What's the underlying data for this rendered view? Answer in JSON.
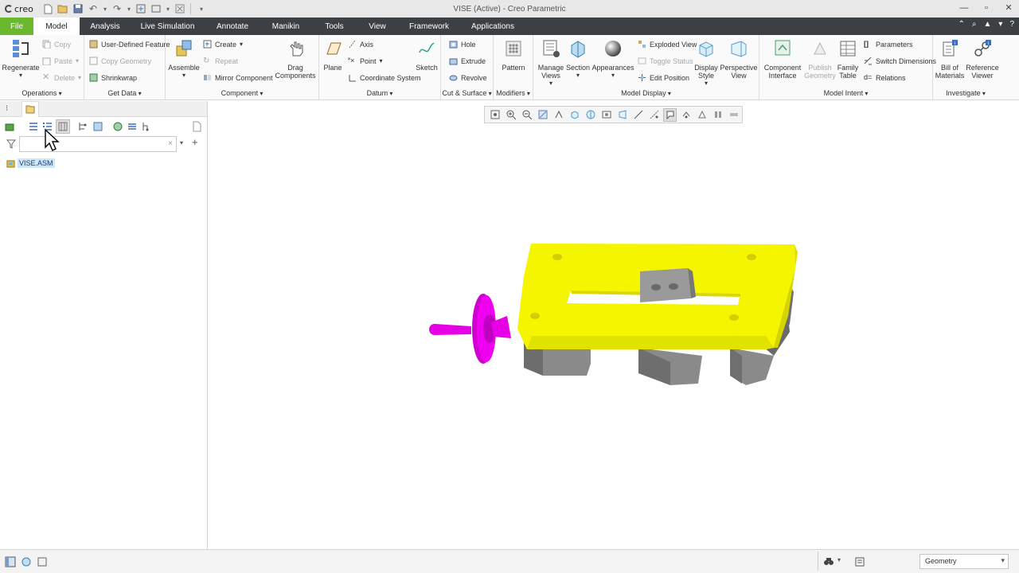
{
  "app": {
    "logo_text": "creo",
    "window_title": "VISE (Active) - Creo Parametric"
  },
  "tabs": [
    "File",
    "Model",
    "Analysis",
    "Live Simulation",
    "Annotate",
    "Manikin",
    "Tools",
    "View",
    "Framework",
    "Applications"
  ],
  "ribbon": {
    "operations": {
      "label": "Operations",
      "regenerate": "Regenerate",
      "copy": "Copy",
      "paste": "Paste",
      "delete": "Delete"
    },
    "get_data": {
      "label": "Get Data",
      "user_defined_feature": "User-Defined Feature",
      "copy_geometry": "Copy Geometry",
      "shrinkwrap": "Shrinkwrap"
    },
    "component": {
      "label": "Component",
      "assemble": "Assemble",
      "create": "Create",
      "repeat": "Repeat",
      "mirror_component": "Mirror Component",
      "drag_components": "Drag Components"
    },
    "datum": {
      "label": "Datum",
      "plane": "Plane",
      "axis": "Axis",
      "point": "Point",
      "coordinate_system": "Coordinate System",
      "sketch": "Sketch"
    },
    "cut_surface": {
      "label": "Cut & Surface",
      "hole": "Hole",
      "extrude": "Extrude",
      "revolve": "Revolve"
    },
    "modifiers": {
      "label": "Modifiers",
      "pattern": "Pattern"
    },
    "model_display": {
      "label": "Model Display",
      "manage_views": "Manage Views",
      "section": "Section",
      "appearances": "Appearances",
      "exploded_view": "Exploded View",
      "toggle_status": "Toggle Status",
      "edit_position": "Edit Position",
      "display_style": "Display Style",
      "perspective_view": "Perspective View"
    },
    "model_intent": {
      "label": "Model Intent",
      "component_interface": "Component Interface",
      "publish_geometry": "Publish Geometry",
      "family_table": "Family Table",
      "parameters": "Parameters",
      "switch_dimensions": "Switch Dimensions",
      "relations": "Relations"
    },
    "investigate": {
      "label": "Investigate",
      "bill_of_materials": "Bill of Materials",
      "reference_viewer": "Reference Viewer"
    }
  },
  "model_tree": {
    "filter_clear": "×",
    "filter_add": "+",
    "root_item": "VISE.ASM"
  },
  "statusbar": {
    "selection_filter": "Geometry"
  },
  "colors": {
    "file_tab": "#6bb82f",
    "tab_bar": "#3c4043",
    "vise_body": "#f5f500",
    "handle": "#e600e6",
    "steel": "#8c8c8c"
  }
}
